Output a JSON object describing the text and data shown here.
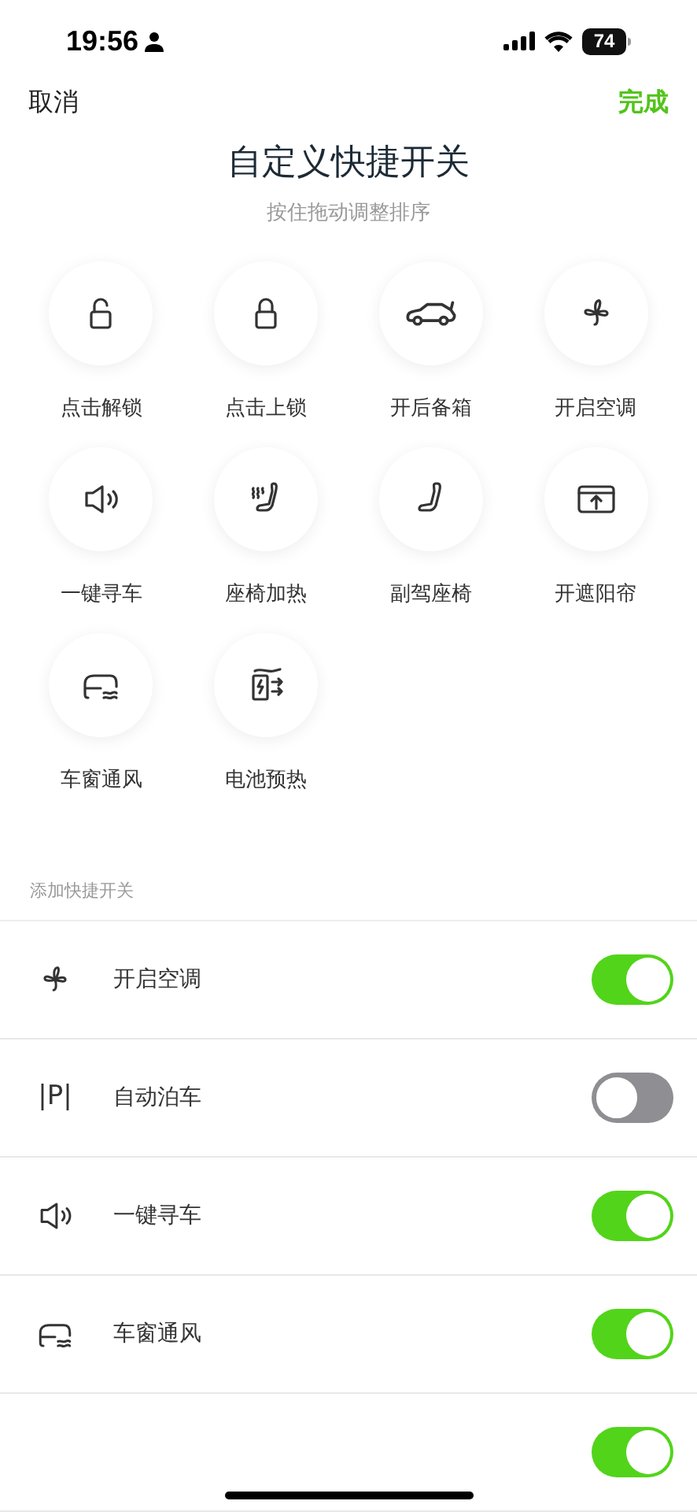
{
  "status_bar": {
    "time": "19:56",
    "battery": "74"
  },
  "nav": {
    "cancel": "取消",
    "done": "完成"
  },
  "header": {
    "title": "自定义快捷开关",
    "subtitle": "按住拖动调整排序"
  },
  "shortcuts": [
    {
      "kind": "unlock",
      "label": "点击解锁"
    },
    {
      "kind": "lock",
      "label": "点击上锁"
    },
    {
      "kind": "trunk",
      "label": "开后备箱"
    },
    {
      "kind": "fan",
      "label": "开启空调"
    },
    {
      "kind": "horn",
      "label": "一键寻车"
    },
    {
      "kind": "seat-heat",
      "label": "座椅加热"
    },
    {
      "kind": "seat",
      "label": "副驾座椅"
    },
    {
      "kind": "sunshade",
      "label": "开遮阳帘"
    },
    {
      "kind": "window",
      "label": "车窗通风"
    },
    {
      "kind": "battery",
      "label": "电池预热"
    }
  ],
  "add_section": {
    "title": "添加快捷开关",
    "rows": [
      {
        "kind": "fan",
        "label": "开启空调",
        "on": true
      },
      {
        "kind": "text",
        "icon_text": "|P|",
        "label": "自动泊车",
        "on": false
      },
      {
        "kind": "horn",
        "label": "一键寻车",
        "on": true
      },
      {
        "kind": "window",
        "label": "车窗通风",
        "on": true
      },
      {
        "on": true
      }
    ]
  }
}
